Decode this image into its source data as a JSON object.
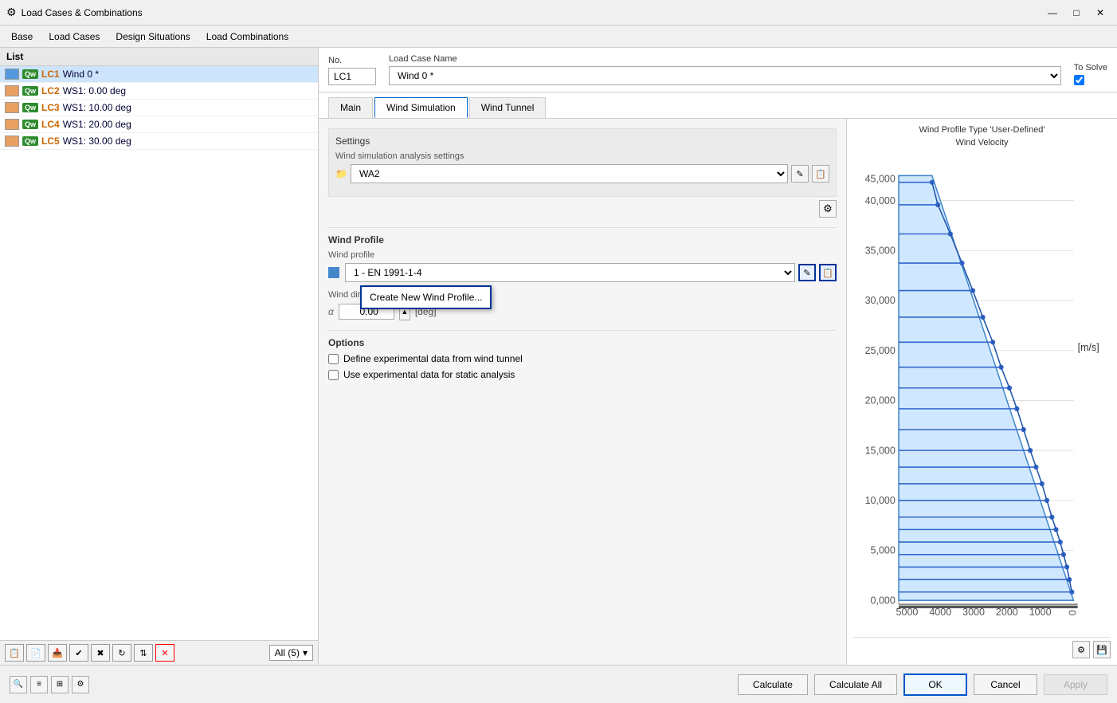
{
  "titleBar": {
    "icon": "⚙",
    "title": "Load Cases & Combinations",
    "minimize": "—",
    "maximize": "□",
    "close": "✕"
  },
  "menuBar": {
    "items": [
      "Base",
      "Load Cases",
      "Design Situations",
      "Load Combinations"
    ]
  },
  "leftPanel": {
    "listHeader": "List",
    "items": [
      {
        "color": "#5599dd",
        "badge": "Qw",
        "lc": "LC1",
        "name": "Wind 0 *",
        "selected": true
      },
      {
        "color": "#e8a060",
        "badge": "Qw",
        "lc": "LC2",
        "name": "WS1: 0.00 deg",
        "selected": false
      },
      {
        "color": "#e8a060",
        "badge": "Qw",
        "lc": "LC3",
        "name": "WS1: 10.00 deg",
        "selected": false
      },
      {
        "color": "#e8a060",
        "badge": "Qw",
        "lc": "LC4",
        "name": "WS1: 20.00 deg",
        "selected": false
      },
      {
        "color": "#e8a060",
        "badge": "Qw",
        "lc": "LC5",
        "name": "WS1: 30.00 deg",
        "selected": false
      }
    ],
    "filterLabel": "All (5)"
  },
  "topFields": {
    "noLabel": "No.",
    "noValue": "LC1",
    "nameLabel": "Load Case Name",
    "nameValue": "Wind 0 *",
    "toSolveLabel": "To Solve"
  },
  "tabs": {
    "items": [
      "Main",
      "Wind Simulation",
      "Wind Tunnel"
    ],
    "active": "Wind Simulation"
  },
  "settings": {
    "settingsTitle": "Settings",
    "analysisLabel": "Wind simulation analysis settings",
    "analysisValue": "WA2",
    "windProfileTitle": "Wind Profile",
    "windProfileLabel": "Wind profile",
    "windProfileValue": "1 - EN 1991-1-4",
    "directionLabel": "Wind direction around Z-axis (clockwise)",
    "alphaLabel": "α",
    "alphaValue": "0.00",
    "alphaUnit": "[deg]",
    "optionsTitle": "Options",
    "option1": "Define experimental data from wind tunnel",
    "option2": "Use experimental data for static analysis"
  },
  "popup": {
    "createLabel": "Create New Wind Profile..."
  },
  "chart": {
    "title1": "Wind Profile Type 'User-Defined'",
    "title2": "Wind Velocity",
    "unit": "[m/s]",
    "yLabels": [
      "45,000",
      "40,000",
      "35,000",
      "30,000",
      "25,000",
      "20,000",
      "15,000",
      "10,000",
      "5,000",
      "0,000"
    ],
    "xLabels": [
      "5000",
      "4000",
      "3000",
      "2000",
      "1000",
      "0"
    ]
  },
  "bottomBar": {
    "calculateLabel": "Calculate",
    "calculateAllLabel": "Calculate All",
    "okLabel": "OK",
    "cancelLabel": "Cancel",
    "applyLabel": "Apply"
  },
  "toolbar": {
    "searchIcon": "🔍",
    "listIcon": "≡",
    "treeIcon": "⊞",
    "settingsIcon": "⚙"
  }
}
